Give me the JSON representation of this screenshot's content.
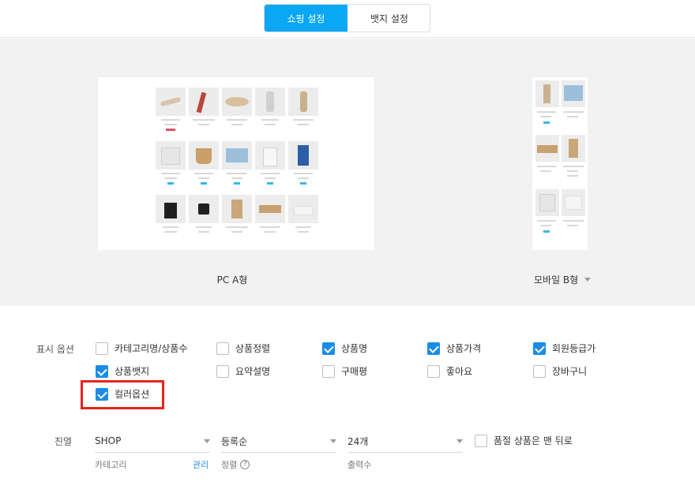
{
  "tabs": [
    {
      "label": "쇼핑 설정",
      "active": true
    },
    {
      "label": "뱃지 설정",
      "active": false
    }
  ],
  "preview": {
    "pc_label": "PC A형",
    "mobile_label": "모바일 B형"
  },
  "options": {
    "label": "표시 옵션",
    "items": [
      {
        "label": "카테고리명/상품수",
        "checked": false
      },
      {
        "label": "상품정렬",
        "checked": false
      },
      {
        "label": "상품명",
        "checked": true
      },
      {
        "label": "상품가격",
        "checked": true
      },
      {
        "label": "회원등급가",
        "checked": true
      },
      {
        "label": "상품뱃지",
        "checked": true
      },
      {
        "label": "요약설명",
        "checked": false
      },
      {
        "label": "구매평",
        "checked": false
      },
      {
        "label": "좋아요",
        "checked": false
      },
      {
        "label": "장바구니",
        "checked": false
      },
      {
        "label": "컬러옵션",
        "checked": true
      }
    ]
  },
  "sort": {
    "label": "진열",
    "category_value": "SHOP",
    "category_caption": "카테고리",
    "manage_link": "관리",
    "order_value": "등록순",
    "order_caption": "정렬",
    "count_value": "24개",
    "count_caption": "출력수",
    "soldout_label": "품절 상품은 맨 뒤로",
    "soldout_checked": false
  },
  "colors": {
    "accent": "#0aa7f5",
    "checkbox": "#1a8ce6",
    "highlight": "#e8231c"
  }
}
